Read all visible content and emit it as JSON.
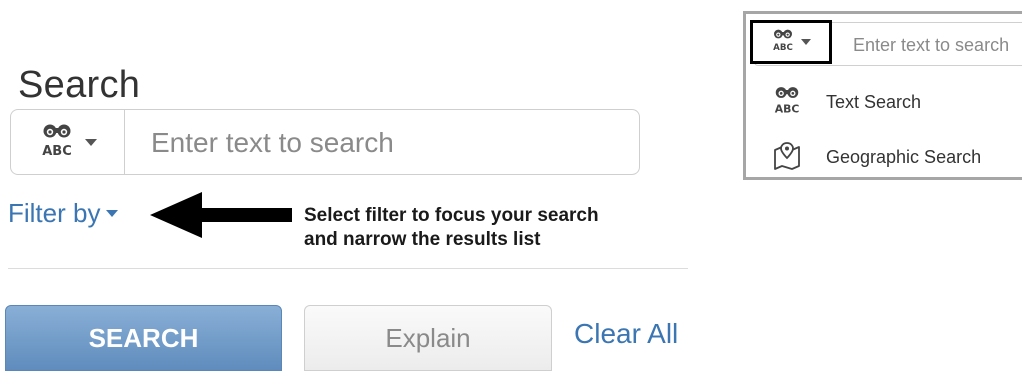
{
  "search": {
    "title": "Search",
    "placeholder": "Enter text to search",
    "filter_label": "Filter by",
    "callout_line1": "Select filter to focus your search",
    "callout_line2": "and narrow the results list",
    "buttons": {
      "search": "SEARCH",
      "explain": "Explain",
      "clear": "Clear All"
    }
  },
  "dropdown": {
    "placeholder": "Enter text to search",
    "items": [
      {
        "label": "Text Search",
        "icon": "binoculars-abc-icon"
      },
      {
        "label": "Geographic Search",
        "icon": "map-pin-icon"
      }
    ]
  },
  "colors": {
    "link": "#3b76b3",
    "primary_button": "#6f98c6",
    "text": "#333333"
  }
}
